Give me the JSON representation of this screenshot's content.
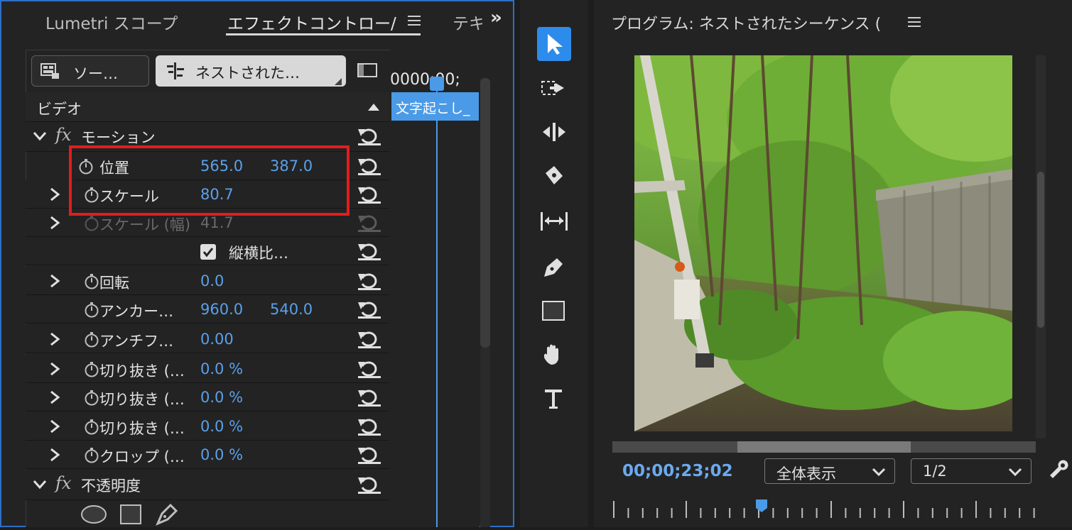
{
  "tabs": {
    "lumetri": "Lumetri スコープ",
    "effect_controls": "エフェクトコントロー/",
    "text": "テキ",
    "more": "»"
  },
  "source_buttons": {
    "source": "ソー…",
    "nested": "ネストされた…"
  },
  "timeline": {
    "timecode": "0000;00;",
    "clip_label": "文字起こし_"
  },
  "section_video": "ビデオ",
  "motion": {
    "label": "モーション",
    "fx": "fx",
    "position": {
      "label": "位置",
      "x": "565.0",
      "y": "387.0"
    },
    "scale": {
      "label": "スケール",
      "value": "80.7"
    },
    "scale_width": {
      "label": "スケール (幅)",
      "value": "41.7"
    },
    "uniform_scale": {
      "label": "縦横比…",
      "checked": true
    },
    "rotation": {
      "label": "回転",
      "value": "0.0"
    },
    "anchor": {
      "label": "アンカー…",
      "x": "960.0",
      "y": "540.0"
    },
    "antiflicker": {
      "label": "アンチフ…",
      "value": "0.00"
    },
    "crop1": {
      "label": "切り抜き (…",
      "value": "0.0 %"
    },
    "crop2": {
      "label": "切り抜き (…",
      "value": "0.0 %"
    },
    "crop3": {
      "label": "切り抜き (…",
      "value": "0.0 %"
    },
    "crop4": {
      "label": "クロップ (…",
      "value": "0.0 %"
    }
  },
  "opacity": {
    "label": "不透明度",
    "fx": "fx"
  },
  "program": {
    "title": "プログラム: ネストされたシーケンス (",
    "timecode": "00;00;23;02",
    "zoom": "全体表示",
    "resolution": "1/2"
  },
  "colors": {
    "accent": "#2d8ceb",
    "value_blue": "#5aa0ea",
    "highlight_red": "#e21d1d",
    "timecode_blue": "#6aaaf0"
  },
  "tools": [
    "selection-icon",
    "track-select-icon",
    "ripple-edit-icon",
    "razor-icon",
    "slip-icon",
    "pen-icon",
    "rectangle-icon",
    "hand-icon",
    "type-icon"
  ]
}
